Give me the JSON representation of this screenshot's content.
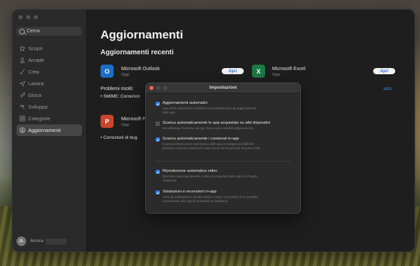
{
  "sidebar": {
    "search_placeholder": "Cerca",
    "items": [
      {
        "label": "Scopri",
        "icon": "star-icon"
      },
      {
        "label": "Arcade",
        "icon": "joystick-icon"
      },
      {
        "label": "Crea",
        "icon": "brush-icon"
      },
      {
        "label": "Lavora",
        "icon": "paperplane-icon"
      },
      {
        "label": "Gioca",
        "icon": "rocket-icon"
      },
      {
        "label": "Sviluppa",
        "icon": "hammer-icon"
      },
      {
        "label": "Categorie",
        "icon": "grid-icon"
      },
      {
        "label": "Aggiornamenti",
        "icon": "download-icon",
        "active": true
      }
    ],
    "user": {
      "initials": "JL",
      "name": "Jessica"
    }
  },
  "main": {
    "title": "Aggiornamenti",
    "section_title": "Aggiornamenti recenti",
    "apps": [
      {
        "name": "Microsoft Outlook",
        "date": "Oggi",
        "button": "Apri",
        "icon_letter": "O",
        "color": "#1a6fc9"
      },
      {
        "name": "Microsoft Excel",
        "date": "Oggi",
        "button": "Apri",
        "icon_letter": "X",
        "color": "#1d7a44"
      },
      {
        "name": "Microsoft P",
        "date": "Oggi",
        "icon_letter": "P",
        "color": "#c9452b"
      }
    ],
    "issues_title": "Problemi risolti:",
    "issues_line": "• SMIME: Correzion",
    "more_link": "altro",
    "bugs_line": "• Correzioni di bug"
  },
  "dialog": {
    "title": "Impostazioni",
    "options": [
      {
        "label": "Aggiornamenti automatici",
        "checked": true,
        "desc": [
          "App Store scaricherà e installerà automaticamente gli aggiornamenti",
          "delle app."
        ]
      },
      {
        "label": "Scarica automaticamente le app acquistate su altri dispositivi",
        "checked": false,
        "desc": [
          "Hai effettuato l'accesso ad App Store come malefisho@gmail.com."
        ]
      },
      {
        "label": "Scarica automaticamente i contenuti in-app",
        "checked": true,
        "desc": [
          "Consenti l'esecuzione automatica delle app in background affinché",
          "possano scaricare contenuti in-app prima che le avvii per la prima volta."
        ]
      },
      {
        "label": "Riproduzione automatica video",
        "checked": true,
        "desc": [
          "Riproduci automaticamente i video di anteprima delle app con l'audio",
          "disattivato."
        ]
      },
      {
        "label": "Valutazioni e recensioni in-app",
        "checked": true,
        "desc": [
          "Aiuta gli sviluppatori e gli altri utenti a capire cosa pensi di un prodotto",
          "consentendo alle app di richiederti un feedback."
        ]
      }
    ]
  },
  "colors": {
    "accent": "#2f7bf0",
    "link": "#3a8ee6",
    "close": "#ff5f57",
    "minimize": "#febc2e",
    "zoom": "#28c840"
  }
}
